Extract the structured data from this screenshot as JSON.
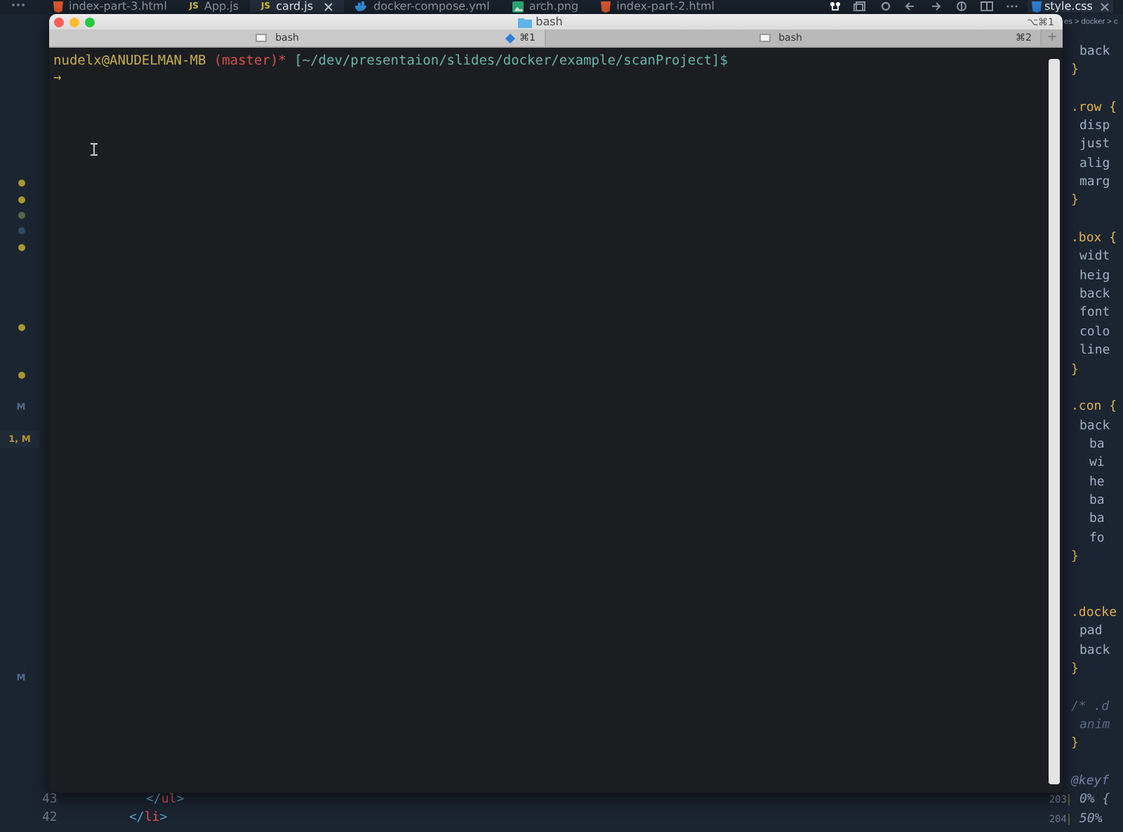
{
  "editor": {
    "tabs": [
      {
        "label": "index-part-3.html",
        "kind": "html",
        "selected": false
      },
      {
        "label": "App.js",
        "kind": "js",
        "icon_text": "JS",
        "selected": false
      },
      {
        "label": "card.js",
        "kind": "js",
        "icon_text": "JS",
        "selected": true
      },
      {
        "label": "docker-compose.yml",
        "kind": "docker",
        "selected": false
      },
      {
        "label": "arch.png",
        "kind": "image",
        "selected": false
      },
      {
        "label": "index-part-2.html",
        "kind": "html",
        "selected": false
      }
    ],
    "side_tabs": [
      {
        "label": "style.css",
        "kind": "css",
        "selected": true
      }
    ],
    "breadcrumb": "es > docker > c",
    "gutter": [
      {
        "kind": "dot",
        "color": "#a8962e"
      },
      {
        "kind": "dot",
        "color": "#a8962e"
      },
      {
        "kind": "dot",
        "color": "#56664f"
      },
      {
        "kind": "dot",
        "color": "#2e4a6a"
      },
      {
        "kind": "dot",
        "color": "#a8962e"
      },
      {
        "kind": "blank"
      },
      {
        "kind": "blank"
      },
      {
        "kind": "blank"
      },
      {
        "kind": "blank"
      },
      {
        "kind": "dot",
        "color": "#a8962e"
      },
      {
        "kind": "blank"
      },
      {
        "kind": "blank"
      },
      {
        "kind": "dot",
        "color": "#a8962e"
      },
      {
        "kind": "blank"
      },
      {
        "kind": "badge",
        "text": "M",
        "color": "#4f6a8f"
      },
      {
        "kind": "blank"
      },
      {
        "kind": "badge",
        "text": "1, M",
        "color": "#b5952c"
      }
    ],
    "gutter_tail": {
      "text": "M",
      "color": "#4f6a8f"
    },
    "lines": [
      {
        "number": "43",
        "kind": "inner",
        "text": "</ul>"
      },
      {
        "number": "42",
        "kind": "outer",
        "text": "</li>"
      }
    ],
    "side_lines": [
      {
        "kind": "prop",
        "text": "back"
      },
      {
        "kind": "brace",
        "text": "}"
      },
      {
        "kind": "blank"
      },
      {
        "kind": "selector",
        "text": ".row {"
      },
      {
        "kind": "prop",
        "text": "disp"
      },
      {
        "kind": "prop",
        "text": "just"
      },
      {
        "kind": "prop",
        "text": "alig"
      },
      {
        "kind": "prop",
        "text": "marg"
      },
      {
        "kind": "brace",
        "text": "}"
      },
      {
        "kind": "blank"
      },
      {
        "kind": "selector",
        "text": ".box {"
      },
      {
        "kind": "prop",
        "text": "widt"
      },
      {
        "kind": "prop",
        "text": "heig"
      },
      {
        "kind": "prop",
        "text": "back"
      },
      {
        "kind": "prop",
        "text": "font"
      },
      {
        "kind": "prop",
        "text": "colo"
      },
      {
        "kind": "prop",
        "text": "line"
      },
      {
        "kind": "brace",
        "text": "}"
      },
      {
        "kind": "blank"
      },
      {
        "kind": "selector",
        "text": ".con {"
      },
      {
        "kind": "prop",
        "text": "back"
      },
      {
        "kind": "subprop",
        "text": "ba"
      },
      {
        "kind": "subprop",
        "text": "wi"
      },
      {
        "kind": "subprop",
        "text": "he"
      },
      {
        "kind": "subprop",
        "text": "ba"
      },
      {
        "kind": "subprop",
        "text": "ba"
      },
      {
        "kind": "subprop",
        "text": "fo"
      },
      {
        "kind": "brace",
        "text": "}"
      },
      {
        "kind": "blank"
      },
      {
        "kind": "blank"
      },
      {
        "kind": "selector",
        "text": ".docke"
      },
      {
        "kind": "prop",
        "text": "pad"
      },
      {
        "kind": "prop",
        "text": "back"
      },
      {
        "kind": "brace",
        "text": "}"
      },
      {
        "kind": "blank"
      },
      {
        "kind": "comment",
        "text": "/* .d"
      },
      {
        "kind": "commentprop",
        "text": "anim"
      },
      {
        "kind": "brace",
        "text": "}"
      },
      {
        "kind": "blank"
      },
      {
        "kind": "atrule",
        "text": "@keyf"
      },
      {
        "kind": "keyframe",
        "number": "203",
        "text": "0% {"
      },
      {
        "kind": "keyframe",
        "number": "204",
        "text": "50%"
      }
    ]
  },
  "terminal": {
    "title": "bash",
    "shortcut": "⌥⌘1",
    "tabs": [
      {
        "label": "bash",
        "shortcut": "⌘1",
        "selected": true
      },
      {
        "label": "bash",
        "shortcut": "⌘2",
        "selected": false
      }
    ],
    "new_tab": "+",
    "prompt": {
      "user": "nudelx@ANUDELMAN-MB",
      "branch": "(master)",
      "dirty": "*",
      "path": "[~/dev/presentaion/slides/docker/example/scanProject]$",
      "arrow": "→"
    }
  }
}
